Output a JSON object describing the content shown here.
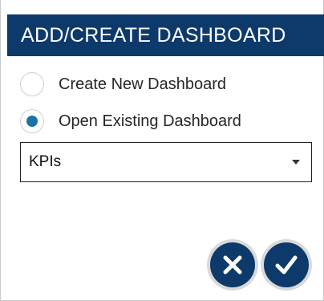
{
  "dialog": {
    "title": "ADD/CREATE DASHBOARD"
  },
  "options": [
    {
      "label": "Create New Dashboard",
      "selected": false
    },
    {
      "label": "Open Existing Dashboard",
      "selected": true
    }
  ],
  "dashboard_select": {
    "value": "KPIs"
  },
  "buttons": {
    "cancel_icon": "close-icon",
    "confirm_icon": "check-icon"
  },
  "colors": {
    "accent": "#0d3a6a",
    "radio_selected": "#1a73a8"
  }
}
